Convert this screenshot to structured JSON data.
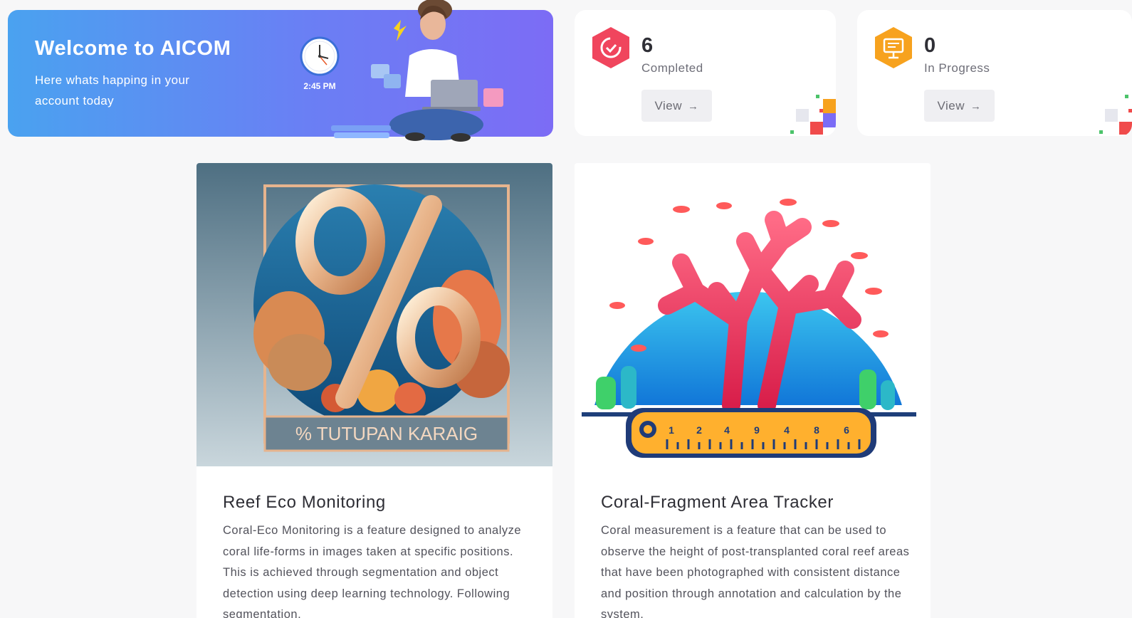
{
  "welcome": {
    "title": "Welcome to AICOM",
    "subtitle": "Here whats happing in your account today",
    "time": "2:45 PM"
  },
  "stats": [
    {
      "value": "6",
      "label": "Completed",
      "button_label": "View",
      "icon": "refresh-check-icon",
      "color": "#f0455d"
    },
    {
      "value": "0",
      "label": "In Progress",
      "button_label": "View",
      "icon": "presentation-board-icon",
      "color": "#f7a21e"
    }
  ],
  "cards": [
    {
      "title": "Reef Eco Monitoring",
      "description": "Coral-Eco Monitoring is a feature designed to analyze coral life-forms in images taken at specific positions. This is achieved through segmentation and object detection using deep learning technology. Following segmentation,",
      "image_caption": "% TUTUPAN  KARAIG"
    },
    {
      "title": "Coral-Fragment Area Tracker",
      "description": "Coral measurement is a feature that can be used to observe the height of post-transplanted coral reef areas that have been photographed with consistent distance and position through annotation and calculation by the system.",
      "ruler_ticks": [
        "1",
        "2",
        "4",
        "9",
        "4",
        "8",
        "6"
      ]
    }
  ],
  "colors": {
    "welcome_gradient_start": "#4aa2f0",
    "welcome_gradient_end": "#7c6cf5",
    "completed_icon": "#f0455d",
    "progress_icon": "#f7a21e"
  }
}
